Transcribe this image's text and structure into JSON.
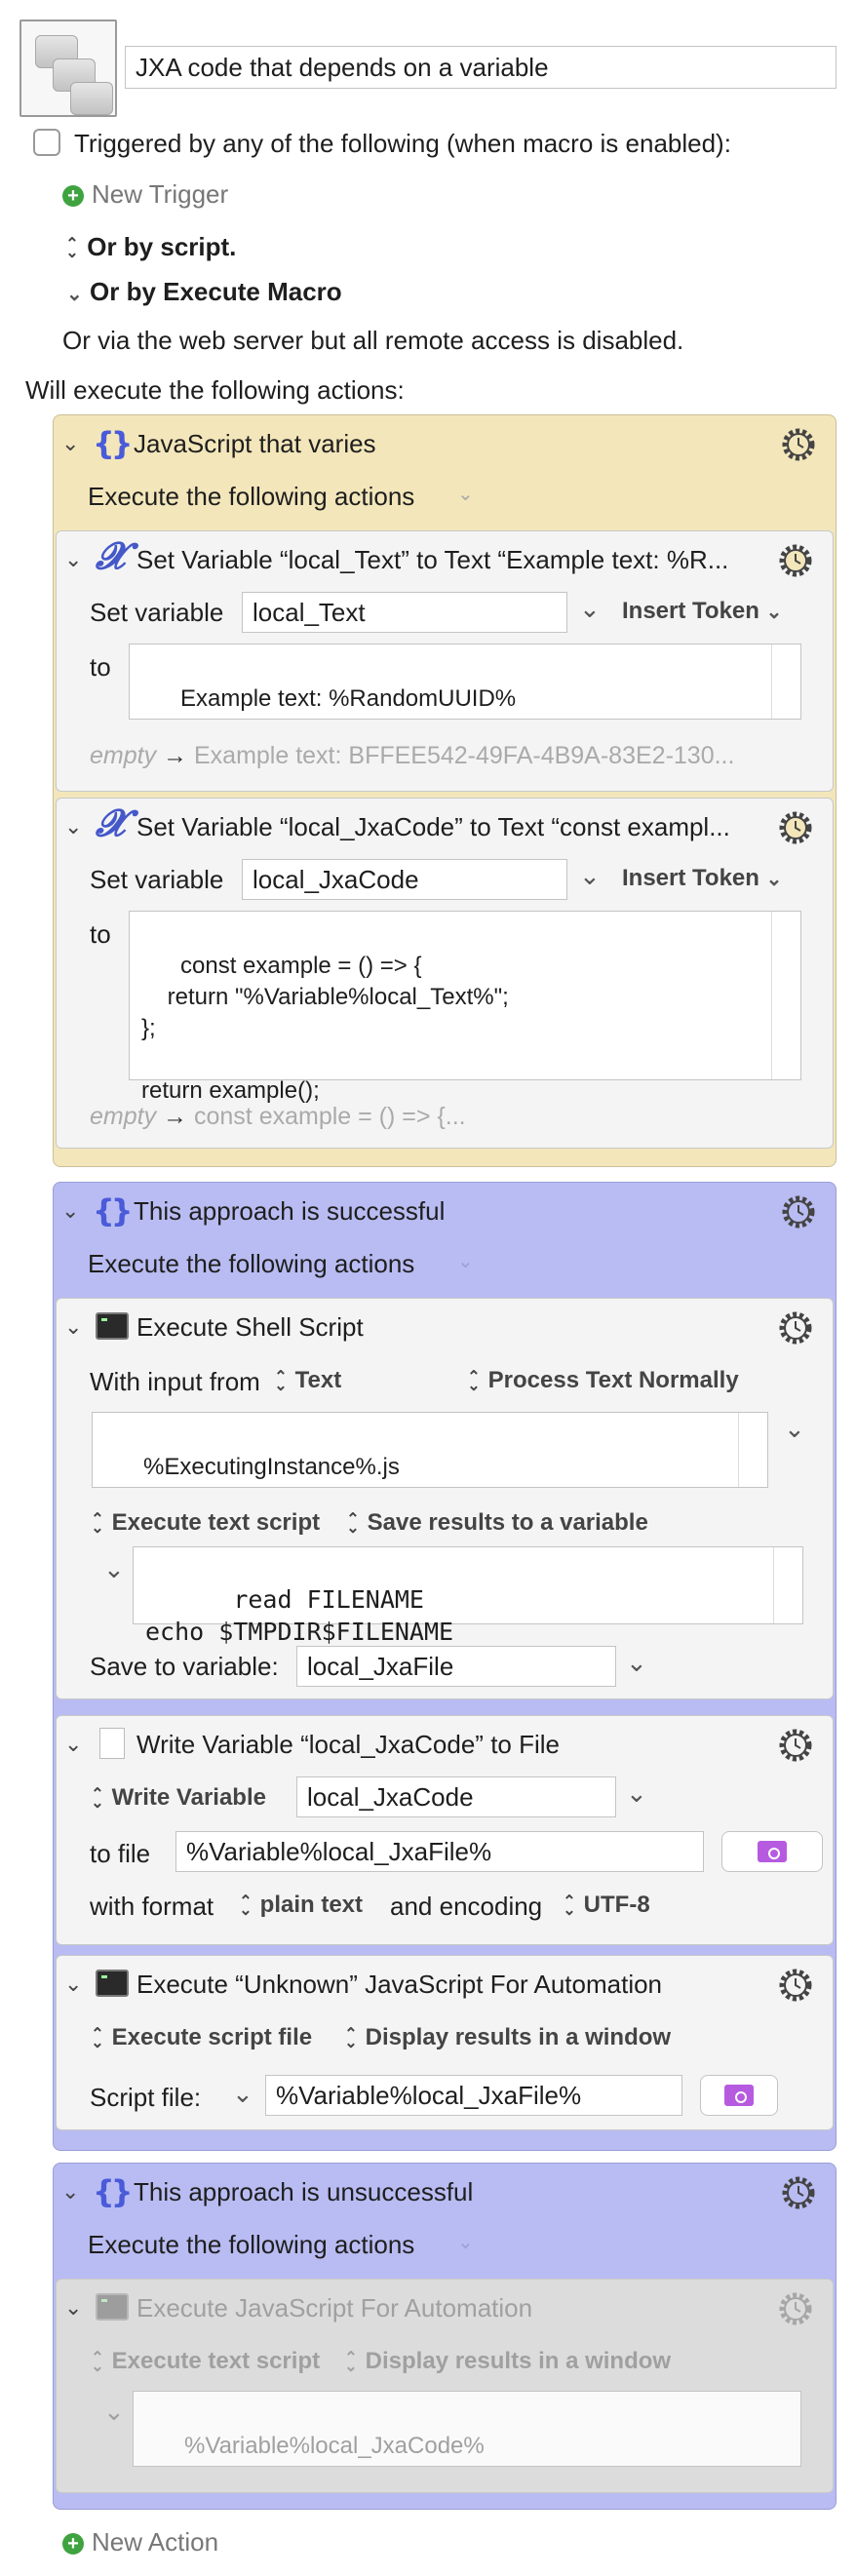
{
  "macro": {
    "name": "JXA code that depends on a variable",
    "trigger_checkbox_label": "Triggered by any of the following (when macro is enabled):",
    "new_trigger": "New Trigger",
    "or_by_script": "Or by script.",
    "or_by_execute_macro": "Or by Execute Macro",
    "web_server_note": "Or via the web server but all remote access is disabled.",
    "will_execute": "Will execute the following actions:",
    "new_action": "New Action"
  },
  "groups": [
    {
      "title": "JavaScript that varies",
      "subtitle": "Execute the following actions",
      "color": "#f3e6ba",
      "actions": [
        {
          "title": "Set Variable “local_Text” to Text “Example text: %R...",
          "set_label": "Set variable",
          "variable": "local_Text",
          "insert_token": "Insert Token",
          "to_label": "to",
          "text": "Example text: %RandomUUID%",
          "result_empty": "empty",
          "result_preview": "Example text: BFFEE542-49FA-4B9A-83E2-130..."
        },
        {
          "title": "Set Variable “local_JxaCode” to Text “const exampl...",
          "set_label": "Set variable",
          "variable": "local_JxaCode",
          "insert_token": "Insert Token",
          "to_label": "to",
          "text": "const example = () => {\n    return \"%Variable%local_Text%\";\n};\n\nreturn example();",
          "result_empty": "empty",
          "result_preview": "const example = () => {..."
        }
      ]
    },
    {
      "title": "This approach is successful",
      "subtitle": "Execute the following actions",
      "color": "#b9bcf2",
      "shell": {
        "title": "Execute Shell Script",
        "input_label": "With input from",
        "input_value": "Text",
        "process_text": "Process Text Normally",
        "input_text": "%ExecutingInstance%.js",
        "execute_mode": "Execute text script",
        "save_mode": "Save results to a variable",
        "script": "read FILENAME\necho $TMPDIR$FILENAME",
        "save_label": "Save to variable:",
        "save_variable": "local_JxaFile"
      },
      "write": {
        "title": "Write Variable “local_JxaCode” to File",
        "write_label": "Write Variable",
        "variable": "local_JxaCode",
        "file_label": "to file",
        "file_path": "%Variable%local_JxaFile%",
        "format_label": "with format",
        "format_value": "plain text",
        "encoding_label": "and encoding",
        "encoding_value": "UTF-8"
      },
      "jxa": {
        "title": "Execute “Unknown” JavaScript For Automation",
        "execute_mode": "Execute script file",
        "display_mode": "Display results in a window",
        "file_label": "Script file:",
        "file_path": "%Variable%local_JxaFile%"
      }
    },
    {
      "title": "This approach is unsuccessful",
      "subtitle": "Execute the following actions",
      "color": "#b9bcf2",
      "jxa": {
        "title": "Execute JavaScript For Automation",
        "execute_mode": "Execute text script",
        "display_mode": "Display results in a window",
        "script": "%Variable%local_JxaCode%"
      }
    }
  ]
}
